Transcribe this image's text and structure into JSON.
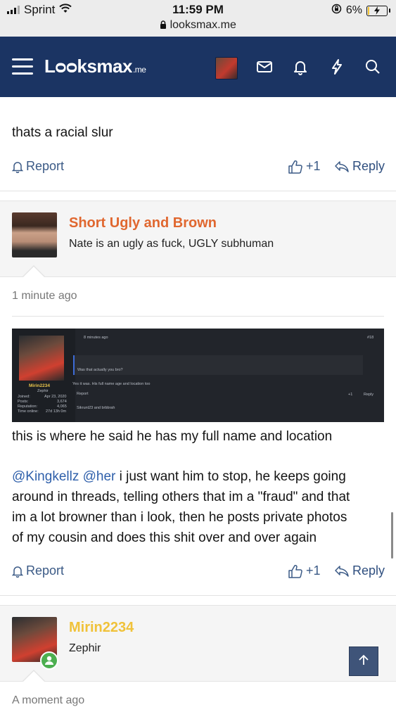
{
  "status_bar": {
    "carrier": "Sprint",
    "time": "11:59 PM",
    "url": "looksmax.me",
    "battery": "6%",
    "battery_level": 0.06
  },
  "header": {
    "logo_text": "Lᴑᴑksmax",
    "logo_suffix": ".me",
    "icons": [
      "menu-icon",
      "avatar",
      "mail-icon",
      "bell-icon",
      "lightning-icon",
      "search-icon"
    ]
  },
  "post1": {
    "text": "thats a racial slur",
    "report": "Report",
    "like_count": "+1",
    "reply": "Reply"
  },
  "quote": {
    "author": "Short Ugly and Brown",
    "author_color": "#e0672f",
    "text": "Nate is an ugly as fuck, UGLY subhuman"
  },
  "post2": {
    "time": "1 minute ago",
    "embed": {
      "time": "8 minutes ago",
      "quote_text": "Was that actually you bro?",
      "reply_text": "Yes it was. His full name age and location too",
      "user": "Mirin2234",
      "title": "Zephir",
      "stats": [
        {
          "label": "Joined:",
          "value": "Apr 23, 2020"
        },
        {
          "label": "Posts:",
          "value": "3,674"
        },
        {
          "label": "Reputation:",
          "value": "4,065"
        },
        {
          "label": "Time online:",
          "value": "27d 13h 0m"
        }
      ],
      "report": "Report",
      "reactions": "Sikrunt23 and brbbrah",
      "like": "+1",
      "reply": "Reply",
      "post_num": "#18"
    },
    "line1": "this is where he said he has my full name and location",
    "mention1": "@Kingkellz",
    "mention2": "@her",
    "line2a": " i just want him to stop, he keeps going",
    "line2b": "around in threads, telling others that im a \"fraud\" and that",
    "line2c": "im a lot browner than i look, then he posts private photos",
    "line2d": "of my cousin and does this shit over and over again",
    "report": "Report",
    "like_count": "+1",
    "reply": "Reply"
  },
  "user_block": {
    "name": "Mirin2234",
    "name_color": "#f0c23a",
    "title": "Zephir",
    "time": "A moment ago"
  },
  "colors": {
    "header_bg": "#1b3463",
    "link": "#3b5a86"
  }
}
